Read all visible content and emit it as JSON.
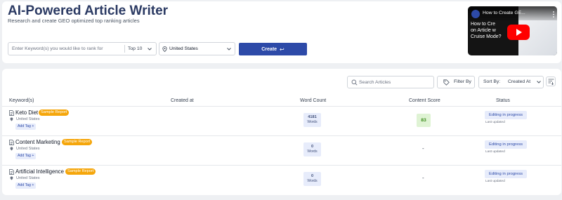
{
  "header": {
    "title": "AI-Powered Article Writer",
    "subtitle": "Research and create GEO optimized top ranking articles"
  },
  "form": {
    "keyword_placeholder": "Enter Keyword(s) you would like to rank for",
    "top_select": "Top 10",
    "location": "United States",
    "create_label": "Create",
    "create_icon": "enter-arrow-icon"
  },
  "video": {
    "title": "How to Create GE...",
    "caption_lines": [
      "How to Cre",
      "on Article w",
      "Cruise Mode?"
    ]
  },
  "toolbar": {
    "search_placeholder": "Search Articles",
    "filter_label": "Filter By",
    "sort_label": "Sort By:",
    "sort_value": "Created At"
  },
  "table": {
    "headers": {
      "keyword": "Keyword(s)",
      "created": "Created at",
      "word_count": "Word Count",
      "content_score": "Content Score",
      "status": "Status"
    },
    "rows": [
      {
        "keyword": "Keto Diet",
        "badge": "Sample Report",
        "location": "United States",
        "tag_label": "Add Tag +",
        "word_count": "4181",
        "word_unit": "Words",
        "score": "83",
        "status": "Editing in progress",
        "status_sub": "Last updated"
      },
      {
        "keyword": "Content Marketing",
        "badge": "Sample Report",
        "location": "United States",
        "tag_label": "Add Tag +",
        "word_count": "0",
        "word_unit": "Words",
        "score": "-",
        "status": "Editing in progress",
        "status_sub": "Last updated"
      },
      {
        "keyword": "Artificial Intelligence",
        "badge": "Sample Report",
        "location": "United States",
        "tag_label": "Add Tag +",
        "word_count": "0",
        "word_unit": "Words",
        "score": "-",
        "status": "Editing in progress",
        "status_sub": "Last updated"
      }
    ]
  },
  "colors": {
    "primary": "#2d4aa8",
    "title": "#2b3a63",
    "badge": "#f5a60b",
    "score_bg": "#dff3d4",
    "score_text": "#3e8e1f",
    "youtube_red": "#ff0000"
  }
}
